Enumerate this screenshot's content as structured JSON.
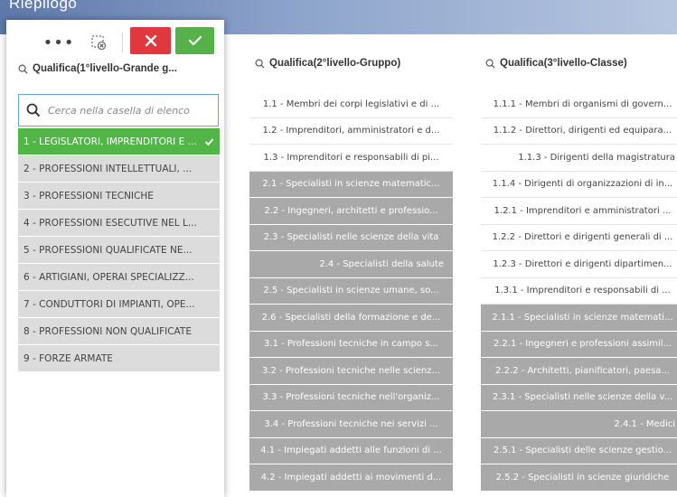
{
  "header": {
    "title": "Riepilogo"
  },
  "toolbar": {
    "more_label": "•••"
  },
  "col1": {
    "title": "Qualifica(1°livello-Grande g...",
    "search_placeholder": "Cerca nella casella di elenco",
    "items": [
      {
        "label": "1 - LEGISLATORI, IMPRENDITORI E ...",
        "state": "selected"
      },
      {
        "label": "2 - PROFESSIONI INTELLETTUALI, ...",
        "state": "alternative"
      },
      {
        "label": "3 - PROFESSIONI TECNICHE",
        "state": "alternative"
      },
      {
        "label": "4 - PROFESSIONI ESECUTIVE NEL L...",
        "state": "alternative"
      },
      {
        "label": "5 - PROFESSIONI QUALIFICATE NE...",
        "state": "alternative"
      },
      {
        "label": "6 - ARTIGIANI, OPERAI SPECIALIZZ...",
        "state": "alternative"
      },
      {
        "label": "7 - CONDUTTORI DI IMPIANTI, OPE...",
        "state": "alternative"
      },
      {
        "label": "8 - PROFESSIONI NON QUALIFICATE",
        "state": "alternative"
      },
      {
        "label": "9 - FORZE ARMATE",
        "state": "alternative"
      }
    ]
  },
  "col2": {
    "title": "Qualifica(2°livello-Gruppo)",
    "items": [
      {
        "label": "1.1 - Membri dei corpi legislativi e di ...",
        "state": "possible"
      },
      {
        "label": "1.2 - Imprenditori, amministratori e d...",
        "state": "possible"
      },
      {
        "label": "1.3 - Imprenditori e responsabili di pi...",
        "state": "possible"
      },
      {
        "label": "2.1 - Specialisti in scienze matematic...",
        "state": "excluded"
      },
      {
        "label": "2.2 - Ingegneri, architetti e professio...",
        "state": "excluded"
      },
      {
        "label": "2.3 - Specialisti nelle scienze della vita",
        "state": "excluded"
      },
      {
        "label": "2.4 - Specialisti della salute",
        "state": "excluded",
        "align": "right"
      },
      {
        "label": "2.5 - Specialisti in scienze umane, so...",
        "state": "excluded"
      },
      {
        "label": "2.6 - Specialisti della formazione e de...",
        "state": "excluded"
      },
      {
        "label": "3.1 - Professioni tecniche in campo s...",
        "state": "excluded"
      },
      {
        "label": "3.2 - Professioni tecniche nelle scienz...",
        "state": "excluded"
      },
      {
        "label": "3.3 - Professioni tecniche nell'organiz...",
        "state": "excluded"
      },
      {
        "label": "3.4 - Professioni tecniche nei servizi ...",
        "state": "excluded"
      },
      {
        "label": "4.1 - Impiegati addetti alle funzioni di ...",
        "state": "excluded"
      },
      {
        "label": "4.2 - Impiegati addetti ai movimenti d...",
        "state": "excluded"
      }
    ]
  },
  "col3": {
    "title": "Qualifica(3°livello-Classe)",
    "items": [
      {
        "label": "1.1.1 - Membri di organismi di govern...",
        "state": "possible"
      },
      {
        "label": "1.1.2 - Direttori, dirigenti ed equipara...",
        "state": "possible"
      },
      {
        "label": "1.1.3 - Dirigenti della magistratura",
        "state": "possible",
        "align": "right"
      },
      {
        "label": "1.1.4 - Dirigenti di organizzazioni di in...",
        "state": "possible"
      },
      {
        "label": "1.2.1 - Imprenditori e amministratori ...",
        "state": "possible"
      },
      {
        "label": "1.2.2 - Direttori e dirigenti generali di ...",
        "state": "possible"
      },
      {
        "label": "1.2.3 - Direttori e dirigenti dipartimen...",
        "state": "possible"
      },
      {
        "label": "1.3.1 - Imprenditori e responsabili di ...",
        "state": "possible"
      },
      {
        "label": "2.1.1 - Specialisti in scienze matemati...",
        "state": "excluded"
      },
      {
        "label": "2.2.1 - Ingegneri e professioni assimil...",
        "state": "excluded"
      },
      {
        "label": "2.2.2 - Architetti, pianificatori, paesa...",
        "state": "excluded"
      },
      {
        "label": "2.3.1 - Specialisti nelle scienze della v...",
        "state": "excluded"
      },
      {
        "label": "2.4.1 - Medici",
        "state": "excluded",
        "align": "right"
      },
      {
        "label": "2.5.1 - Specialisti delle scienze gestio...",
        "state": "excluded"
      },
      {
        "label": "2.5.2 - Specialisti in scienze giuridiche",
        "state": "excluded"
      }
    ]
  },
  "colors": {
    "selected": "#52b547",
    "alternative": "#dcdcdc",
    "excluded": "#a9a9a9",
    "cancel": "#e0383e",
    "confirm": "#57b14a",
    "header": "#5e78ab"
  },
  "icons": {
    "search": "search-icon",
    "more": "more-icon",
    "clear_selections": "clear-selections-icon",
    "cancel": "close-icon",
    "confirm": "check-icon",
    "selected_check": "check-icon"
  }
}
